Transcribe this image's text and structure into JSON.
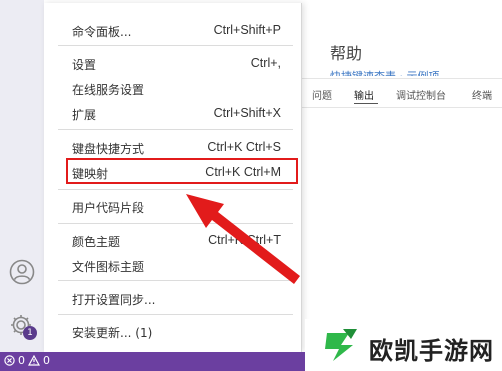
{
  "editor": {
    "welcome_title": "帮助",
    "welcome_sub": "快捷键速查表 · 示例项",
    "panel_tabs": [
      {
        "label": "问题"
      },
      {
        "label": "输出"
      },
      {
        "label": "调试控制台"
      },
      {
        "label": "终端"
      }
    ]
  },
  "menu": {
    "items": [
      {
        "label": "命令面板...",
        "shortcut": "Ctrl+Shift+P"
      },
      {
        "label": "设置",
        "shortcut": "Ctrl+,"
      },
      {
        "label": "在线服务设置",
        "shortcut": ""
      },
      {
        "label": "扩展",
        "shortcut": "Ctrl+Shift+X"
      },
      {
        "label": "键盘快捷方式",
        "shortcut": "Ctrl+K Ctrl+S"
      },
      {
        "label": "键映射",
        "shortcut": "Ctrl+K Ctrl+M"
      },
      {
        "label": "用户代码片段",
        "shortcut": ""
      },
      {
        "label": "颜色主题",
        "shortcut": "Ctrl+K Ctrl+T"
      },
      {
        "label": "文件图标主题",
        "shortcut": ""
      },
      {
        "label": "打开设置同步...",
        "shortcut": ""
      },
      {
        "label": "安装更新... (1)",
        "shortcut": ""
      }
    ]
  },
  "activity_bar": {
    "account_icon": "account-icon",
    "gear_icon": "gear-icon",
    "gear_badge": "1"
  },
  "status_bar": {
    "errors": "0",
    "warnings": "0"
  },
  "watermark": {
    "text": "欧凯手游网"
  },
  "colors": {
    "status_bar": "#6b3fa0",
    "highlight": "#e21b1b",
    "watermark_logo": "#2fb84a"
  }
}
